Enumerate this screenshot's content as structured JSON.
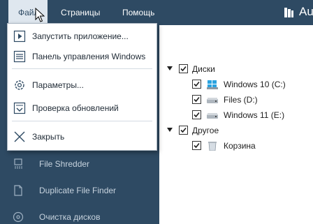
{
  "menubar": {
    "items": [
      {
        "label": "Файл"
      },
      {
        "label": "Страницы"
      },
      {
        "label": "Помощь"
      }
    ],
    "app_title": "Au",
    "colors": {
      "bar": "#2e4a63",
      "active": "#dfe7ef"
    }
  },
  "file_menu": {
    "items": [
      {
        "label": "Запустить приложение...",
        "icon": "play-icon"
      },
      {
        "label": "Панель управления Windows",
        "icon": "control-panel-icon"
      },
      {
        "label": "Параметры...",
        "icon": "gear-icon"
      },
      {
        "label": "Проверка обновлений",
        "icon": "update-icon"
      },
      {
        "label": "Закрыть",
        "icon": "close-icon"
      }
    ]
  },
  "sidebar": {
    "items": [
      {
        "label": "File Shredder",
        "icon": "shredder-icon"
      },
      {
        "label": "Duplicate File Finder",
        "icon": "duplicate-icon"
      },
      {
        "label": "Очистка дисков",
        "icon": "disk-cleanup-icon"
      }
    ]
  },
  "tree": {
    "groups": [
      {
        "label": "Диски",
        "expanded": true,
        "checked": true,
        "children": [
          {
            "label": "Windows 10 (C:)",
            "checked": true,
            "icon": "windows-drive-icon"
          },
          {
            "label": "Files (D:)",
            "checked": true,
            "icon": "drive-icon"
          },
          {
            "label": "Windows 11 (E:)",
            "checked": true,
            "icon": "drive-icon"
          }
        ]
      },
      {
        "label": "Другое",
        "expanded": true,
        "checked": true,
        "children": [
          {
            "label": "Корзина",
            "checked": true,
            "icon": "recycle-bin-icon"
          }
        ]
      }
    ]
  }
}
